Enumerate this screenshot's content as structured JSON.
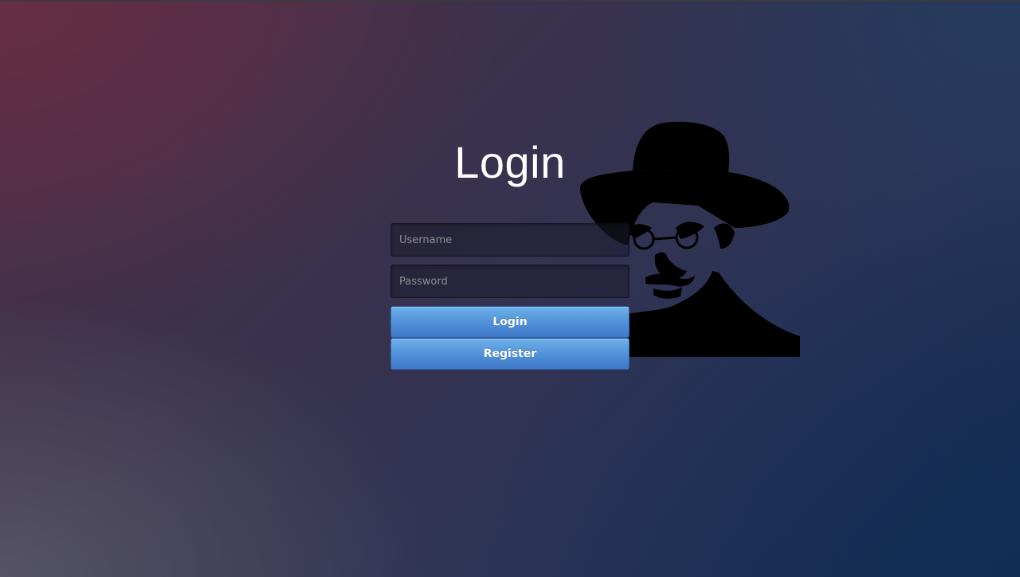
{
  "page": {
    "title": "Login"
  },
  "form": {
    "username_placeholder": "Username",
    "password_placeholder": "Password",
    "username_value": "",
    "password_value": "",
    "login_label": "Login",
    "register_label": "Register"
  },
  "colors": {
    "button_top": "#6eb1e8",
    "button_bottom": "#3f77c6",
    "title_text": "#ffffff"
  },
  "icons": {
    "portrait": "man-in-hat-silhouette"
  }
}
